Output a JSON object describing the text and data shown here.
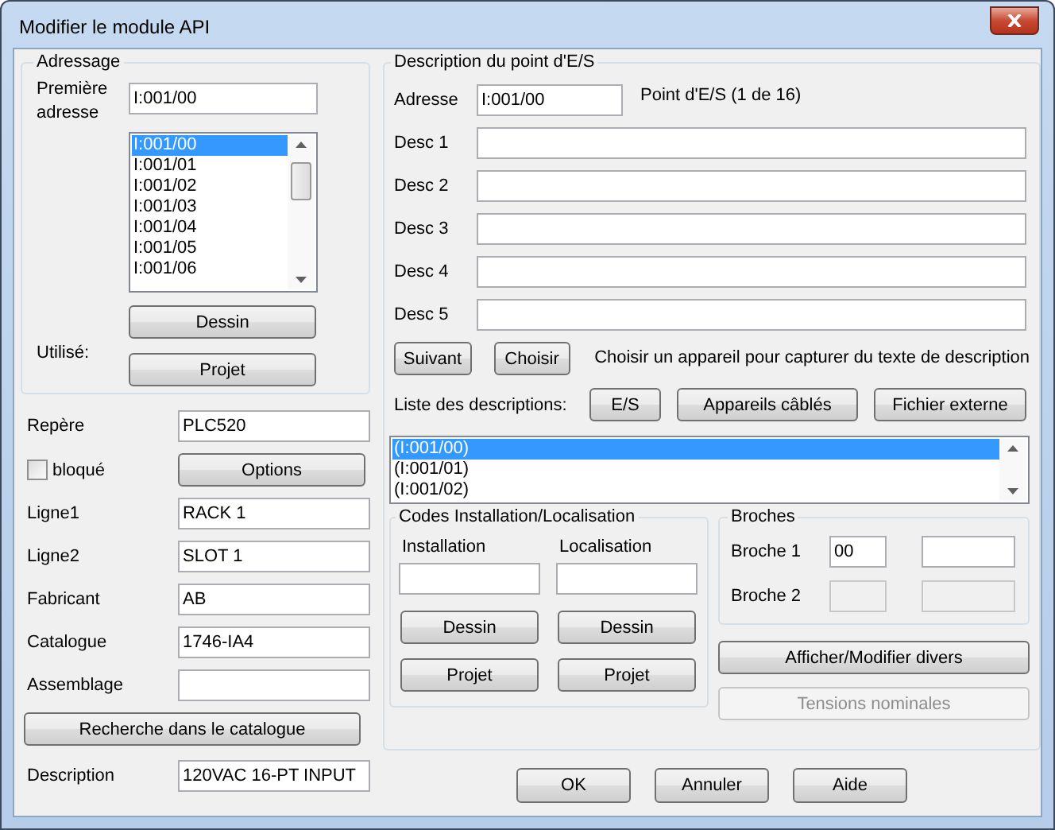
{
  "window": {
    "title": "Modifier le module API"
  },
  "addressing": {
    "title": "Adressage",
    "first_address_label": "Première adresse",
    "first_address": "I:001/00",
    "used_label": "Utilisé:",
    "buttons": [
      "Dessin",
      "Projet"
    ],
    "addresses": [
      {
        "label": "I:001/00",
        "selected": true
      },
      {
        "label": "I:001/01",
        "selected": false
      },
      {
        "label": "I:001/02",
        "selected": false
      },
      {
        "label": "I:001/03",
        "selected": false
      },
      {
        "label": "I:001/04",
        "selected": false
      },
      {
        "label": "I:001/05",
        "selected": false
      },
      {
        "label": "I:001/06",
        "selected": false
      }
    ]
  },
  "fields": [
    {
      "kind": "field",
      "label": "Repère",
      "value": "PLC520"
    },
    {
      "kind": "checkbox",
      "label": "bloqué",
      "checked": false,
      "button": "Options"
    },
    {
      "kind": "field",
      "label": "Ligne1",
      "value": "RACK 1"
    },
    {
      "kind": "field",
      "label": "Ligne2",
      "value": "SLOT 1"
    },
    {
      "kind": "field",
      "label": "Fabricant",
      "value": "AB"
    },
    {
      "kind": "field",
      "label": "Catalogue",
      "value": "1746-IA4"
    },
    {
      "kind": "field",
      "label": "Assemblage"
    }
  ],
  "catalog_button": "Recherche dans le catalogue",
  "description": {
    "label": "Description",
    "value": "120VAC 16-PT INPUT"
  },
  "io_point": {
    "title": "Description du point d'E/S",
    "address_label": "Adresse",
    "address": "I:001/00",
    "position": "Point d'E/S (1 de 16)",
    "descs": [
      {
        "label": "Desc 1"
      },
      {
        "label": "Desc 2"
      },
      {
        "label": "Desc 3"
      },
      {
        "label": "Desc 4"
      },
      {
        "label": "Desc 5"
      }
    ],
    "next_button": "Suivant",
    "choose_button": "Choisir",
    "choose_hint": "Choisir un appareil pour capturer du texte de description",
    "list_label": "Liste des descriptions:",
    "list_buttons": [
      "E/S",
      "Appareils câblés",
      "Fichier externe"
    ],
    "descriptions": [
      {
        "label": "(I:001/00)",
        "selected": true
      },
      {
        "label": "(I:001/01)",
        "selected": false
      },
      {
        "label": "(I:001/02)",
        "selected": false
      }
    ],
    "codes": {
      "title": "Codes Installation/Localisation",
      "columns": [
        {
          "label": "Installation",
          "buttons": [
            "Dessin",
            "Projet"
          ]
        },
        {
          "label": "Localisation",
          "buttons": [
            "Dessin",
            "Projet"
          ]
        }
      ]
    },
    "pins": {
      "title": "Broches",
      "rows": [
        {
          "label": "Broche 1",
          "value": "00",
          "disabled": false
        },
        {
          "label": "Broche 2",
          "disabled": true
        }
      ]
    },
    "misc_button": {
      "label": "Afficher/Modifier divers",
      "disabled": false
    },
    "voltage_button": {
      "label": "Tensions nominales",
      "disabled": true
    }
  },
  "dialog_buttons": [
    "OK",
    "Annuler",
    "Aide"
  ]
}
